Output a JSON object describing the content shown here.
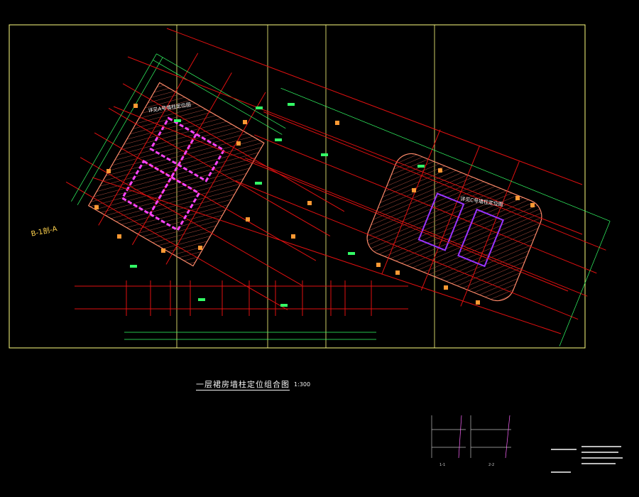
{
  "drawing": {
    "title": "一层裙房墙柱定位组合图",
    "scale": "1:300"
  },
  "annotations": {
    "a_note": "详见A号墙柱定位图",
    "c_note": "详见C号墙柱定位图",
    "section_mark": "B-1剖-A"
  },
  "details": {
    "label_1": "1-1",
    "label_2": "2-2"
  },
  "colors": {
    "background": "#000000",
    "frame": "#ffff80",
    "axis_line": "#e01010",
    "dimension": "#33ff66",
    "hatch_border": "#ff9966",
    "wall": "#ff44ff",
    "column": "#ff9933",
    "text": "#ffffff"
  }
}
